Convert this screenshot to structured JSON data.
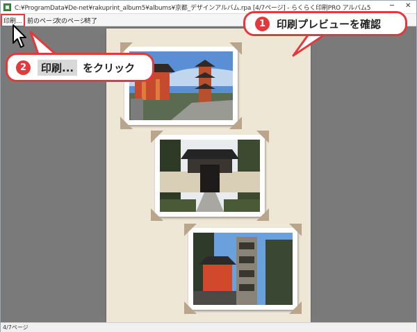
{
  "window": {
    "title": "C:¥ProgramData¥De-net¥rakuprint_album5¥albums¥京都_デザインアルバム.rpa  [4/7ページ] - らくらく印刷PRO アルバム5",
    "minimize_glyph": "─",
    "close_glyph": "✕"
  },
  "menu": {
    "print": "印刷...",
    "prev_page": "前のページ",
    "next_page": "次のページ",
    "exit": "終了"
  },
  "status": {
    "page": "4/7ページ"
  },
  "callouts": {
    "step1": {
      "number": "1",
      "text": "印刷プレビューを確認"
    },
    "step2": {
      "number": "2",
      "chip": "印刷...",
      "text": "をクリック"
    }
  },
  "photos": [
    {
      "subject": "temple-pagoda"
    },
    {
      "subject": "temple-gate"
    },
    {
      "subject": "stone-pillar-shrine"
    }
  ],
  "colors": {
    "accent": "#e5383b",
    "page": "#efe7d6",
    "photo_corner": "#b9a58b",
    "workspace": "#7a7a7a"
  }
}
